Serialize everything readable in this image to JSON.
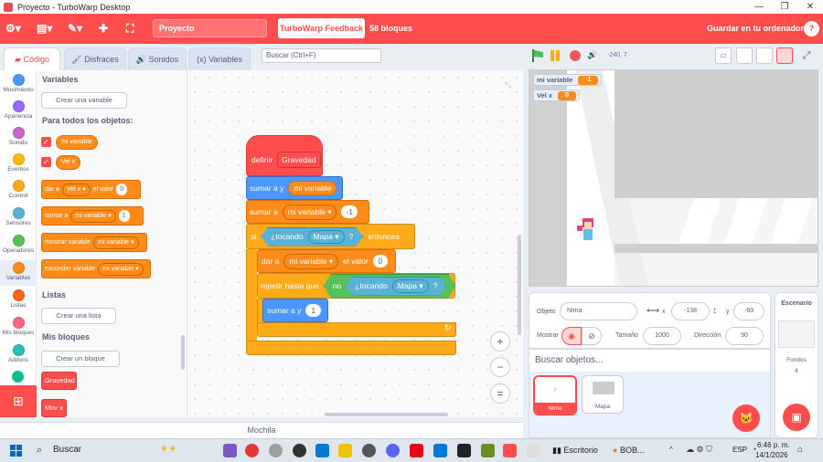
{
  "window": {
    "title": "Proyecto - TurboWarp Desktop",
    "minimize": "—",
    "maximize": "❐",
    "close": "✕"
  },
  "menubar": {
    "project_title": "Proyecto",
    "feedback_label": "TurboWarp Feedback",
    "block_count": "58 bloques",
    "save_label": "Guardar en tu ordenador",
    "help": "?"
  },
  "tabs": {
    "code": "Código",
    "costumes": "Disfraces",
    "sounds": "Sonidos",
    "variables": "Variables"
  },
  "search": {
    "placeholder": "Buscar (Ctrl+F)"
  },
  "stage_header": {
    "coords": "-240, 7"
  },
  "categories": [
    {
      "label": "Movimiento",
      "color": "#4c97ff"
    },
    {
      "label": "Apariencia",
      "color": "#9966ff"
    },
    {
      "label": "Sonido",
      "color": "#cf63cf"
    },
    {
      "label": "Eventos",
      "color": "#ffbf00"
    },
    {
      "label": "Control",
      "color": "#ffab19"
    },
    {
      "label": "Sensores",
      "color": "#5cb1d6"
    },
    {
      "label": "Operadores",
      "color": "#59c059"
    },
    {
      "label": "Variables",
      "color": "#ff8c1a"
    },
    {
      "label": "Listas",
      "color": "#ff661a"
    },
    {
      "label": "Mis bloques",
      "color": "#ff6680"
    },
    {
      "label": "Addons",
      "color": "#29beb8"
    }
  ],
  "palette": {
    "variables_heading": "Variables",
    "make_variable": "Crear una variable",
    "for_all": "Para todos los objetos:",
    "vars": [
      "mi variable",
      "Vel x"
    ],
    "blocks": {
      "set": {
        "a": "dar a",
        "var": "Vel x",
        "b": "el valor",
        "val": "0"
      },
      "change": {
        "a": "sumar a",
        "var": "mi variable",
        "val": "1"
      },
      "show": {
        "a": "mostrar variable",
        "var": "mi variable"
      },
      "hide": {
        "a": "esconder variable",
        "var": "mi variable"
      }
    },
    "lists_heading": "Listas",
    "make_list": "Crear una lista",
    "myblocks_heading": "Mis bloques",
    "make_block": "Crear un bloque",
    "myblocks": [
      "Gravedad",
      "Mov x"
    ]
  },
  "script": {
    "define": "definir",
    "define_name": "Gravedad",
    "change_y": "sumar a y",
    "change_y_val": "mi variable",
    "change_var": "sumar a",
    "change_var_name": "mi variable",
    "change_var_val": "-1",
    "if": "si",
    "touching": "¿tocando",
    "touching_target": "Mapa",
    "q": "?",
    "then": "entonces",
    "set_var": "dar a",
    "set_var_name": "mi variable",
    "set_var_mid": "el valor",
    "set_var_val": "0",
    "repeat_until": "repetir hasta que",
    "not": "no",
    "touching2": "¿tocando",
    "touching2_target": "Mapa",
    "q2": "?",
    "change_y2": "sumar a y",
    "change_y2_val": "1"
  },
  "zoom": {
    "in": "+",
    "out": "−",
    "reset": "="
  },
  "backpack": "Mochila",
  "monitors": [
    {
      "name": "mi variable",
      "value": "-1"
    },
    {
      "name": "Vel x",
      "value": "0"
    }
  ],
  "sprite_info": {
    "sprite_label": "Objeto",
    "sprite_name": "Nima",
    "x_label": "x",
    "x": "-138",
    "y_label": "y",
    "y": "-93",
    "show_label": "Mostrar",
    "size_label": "Tamaño",
    "size": "1000",
    "direction_label": "Dirección",
    "direction": "90"
  },
  "sprite_search": "Buscar objetos...",
  "sprites": [
    {
      "name": "Nima",
      "selected": true
    },
    {
      "name": "Mapa",
      "selected": false
    }
  ],
  "stage_panel": {
    "title": "Escenario",
    "backdrops_label": "Fondos",
    "backdrops": "4"
  },
  "taskbar": {
    "search": "Buscar",
    "app1": "Escritorio",
    "app2": "BOB...",
    "lang": "ESP",
    "time": "6:46 p. m.",
    "date": "14/1/2026"
  },
  "colors": {
    "accent": "#ff4c4c",
    "variables": "#ff8c1a",
    "control": "#ffab19",
    "sensing": "#5cb1d6",
    "operators": "#59c059",
    "motion": "#4c97ff",
    "myblocks": "#ff4c4c"
  }
}
